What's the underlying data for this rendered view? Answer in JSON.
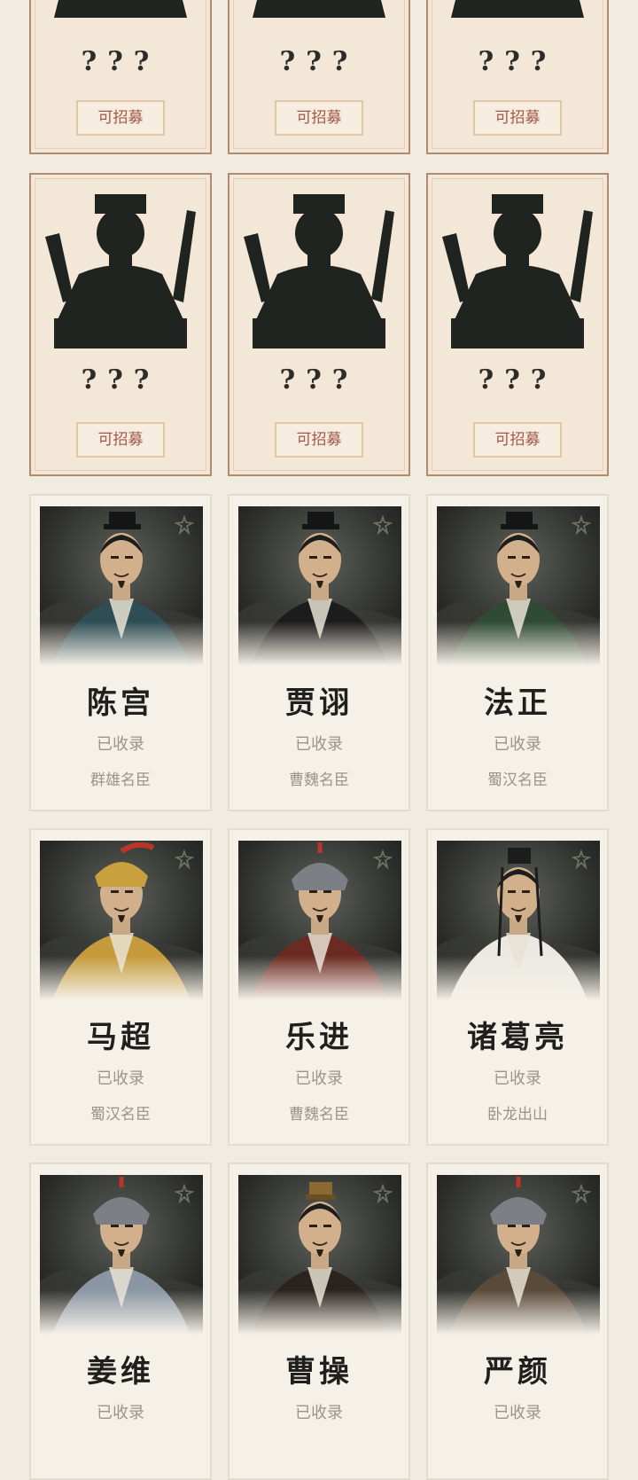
{
  "locked_rows": [
    {
      "cards": [
        {
          "qmarks": "???",
          "button": "可招募"
        },
        {
          "qmarks": "???",
          "button": "可招募"
        },
        {
          "qmarks": "???",
          "button": "可招募"
        }
      ]
    },
    {
      "cards": [
        {
          "qmarks": "???",
          "button": "可招募"
        },
        {
          "qmarks": "???",
          "button": "可招募"
        },
        {
          "qmarks": "???",
          "button": "可招募"
        }
      ]
    }
  ],
  "collected_rows": [
    {
      "cards": [
        {
          "name": "陈宫",
          "status": "已收录",
          "faction": "群雄名臣",
          "robe": "#2e4d55",
          "hat": "official"
        },
        {
          "name": "贾诩",
          "status": "已收录",
          "faction": "曹魏名臣",
          "robe": "#1c1c1c",
          "hat": "official"
        },
        {
          "name": "法正",
          "status": "已收录",
          "faction": "蜀汉名臣",
          "robe": "#2f4a35",
          "hat": "official"
        }
      ]
    },
    {
      "cards": [
        {
          "name": "马超",
          "status": "已收录",
          "faction": "蜀汉名臣",
          "robe": "#c59a3a",
          "hat": "gold-helmet"
        },
        {
          "name": "乐进",
          "status": "已收录",
          "faction": "曹魏名臣",
          "robe": "#6b2a22",
          "hat": "steel-helmet"
        },
        {
          "name": "诸葛亮",
          "status": "已收录",
          "faction": "卧龙出山",
          "robe": "#ece9e2",
          "hat": "scholar"
        }
      ]
    },
    {
      "cards": [
        {
          "name": "姜维",
          "status": "已收录",
          "faction": "",
          "robe": "#8a96a3",
          "hat": "steel-helmet"
        },
        {
          "name": "曹操",
          "status": "已收录",
          "faction": "",
          "robe": "#2a2320",
          "hat": "crown"
        },
        {
          "name": "严颜",
          "status": "已收录",
          "faction": "",
          "robe": "#5a4a3a",
          "hat": "steel-helmet"
        }
      ]
    }
  ]
}
